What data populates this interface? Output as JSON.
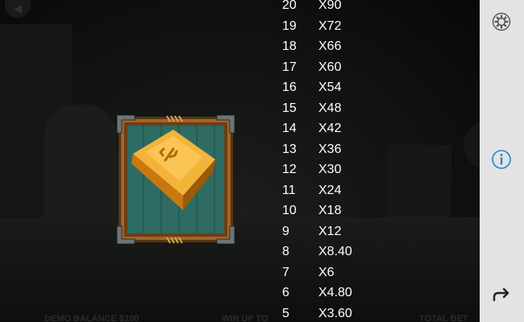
{
  "game": {
    "footer": {
      "balance": "DEMO BALANCE  $100",
      "win": "WIN UP TO",
      "bet": "TOTAL BET"
    }
  },
  "symbol": {
    "name": "gold-bar-with-cactus",
    "colors": {
      "frame": "#7a4a1e",
      "panel": "#2e6b63",
      "gold": "#f0a52a"
    }
  },
  "paytable": [
    {
      "count": "20",
      "multiplier": "X90"
    },
    {
      "count": "19",
      "multiplier": "X72"
    },
    {
      "count": "18",
      "multiplier": "X66"
    },
    {
      "count": "17",
      "multiplier": "X60"
    },
    {
      "count": "16",
      "multiplier": "X54"
    },
    {
      "count": "15",
      "multiplier": "X48"
    },
    {
      "count": "14",
      "multiplier": "X42"
    },
    {
      "count": "13",
      "multiplier": "X36"
    },
    {
      "count": "12",
      "multiplier": "X30"
    },
    {
      "count": "11",
      "multiplier": "X24"
    },
    {
      "count": "10",
      "multiplier": "X18"
    },
    {
      "count": "9",
      "multiplier": "X12"
    },
    {
      "count": "8",
      "multiplier": "X8.40"
    },
    {
      "count": "7",
      "multiplier": "X6"
    },
    {
      "count": "6",
      "multiplier": "X4.80"
    },
    {
      "count": "5",
      "multiplier": "X3.60"
    }
  ],
  "sidebar": {
    "icons": [
      "settings-icon",
      "info-icon",
      "return-icon"
    ],
    "accent": "#1e88c8"
  }
}
